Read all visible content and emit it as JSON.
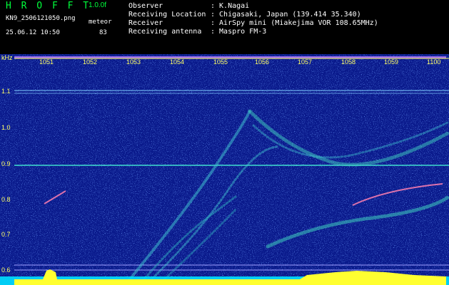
{
  "header": {
    "logo": "H R O F F T",
    "version": "1.0.0f",
    "filename": "KN9_2506121050.png",
    "datetime": "25.06.12 10:50",
    "meteor_label": "meteor",
    "meteor_count": "83"
  },
  "info": {
    "rows": [
      {
        "key": "Observer",
        "value": ": K.Nagai"
      },
      {
        "key": "Receiving Location",
        "value": ": Chigasaki, Japan (139.414 35.340)"
      },
      {
        "key": "Receiver",
        "value": ": AirSpy mini (Miakejima VOR 108.65MHz)"
      },
      {
        "key": "Receiving antenna",
        "value": ": Maspro FM-3"
      }
    ]
  },
  "spectrogram": {
    "y_unit": "kHz",
    "y_ticks": [
      "1.1",
      "1.0",
      "0.9",
      "0.8",
      "0.7",
      "0.6"
    ],
    "x_ticks": [
      "1051",
      "1052",
      "1053",
      "1054",
      "1055",
      "1056",
      "1057",
      "1058",
      "1059",
      "1100"
    ],
    "colors": {
      "background": "#0a1a8c",
      "noise": "#3060ff",
      "signal": "#40e0d0",
      "strong": "#ffff40",
      "axis": "#ffff66"
    }
  }
}
